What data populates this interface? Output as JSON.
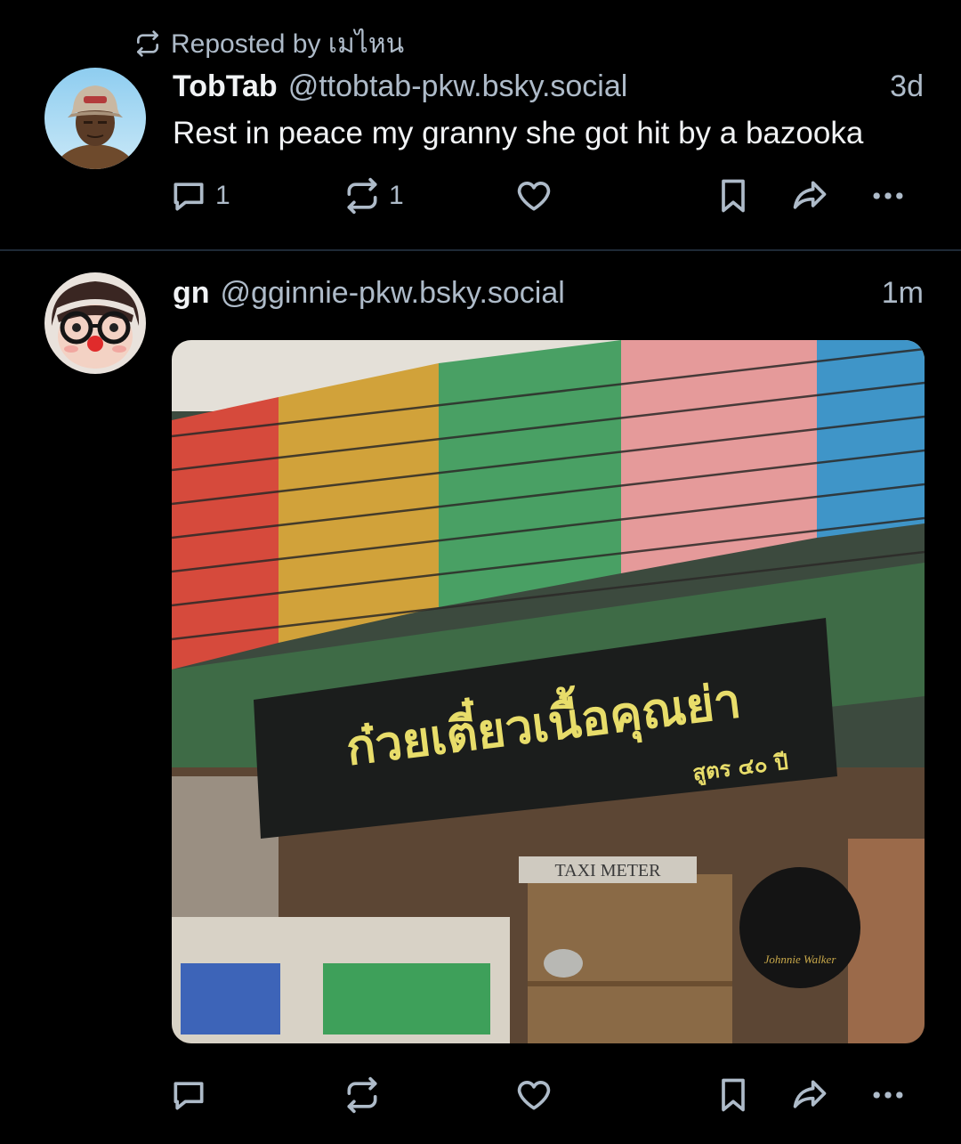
{
  "feed": {
    "post1": {
      "repost_label": "Reposted by เมไหน",
      "display_name": "TobTab",
      "handle": "@ttobtab-pkw.bsky.social",
      "time": "3d",
      "text": "Rest in peace my granny she got hit by a bazooka",
      "reply_count": "1",
      "repost_count": "1",
      "icons": [
        "repost-icon",
        "reply-icon",
        "repost-icon",
        "like-icon",
        "bookmark-icon",
        "share-icon",
        "more-icon"
      ]
    },
    "post2": {
      "display_name": "gn",
      "handle": "@gginnie-pkw.bsky.social",
      "time": "1m",
      "image": {
        "sign_text": "ก๋วยเตี๋ยวเนื้อคุณย่า",
        "sign_subtext": "สูตร ๔๐ ปี",
        "meter_text": "TAXI METER",
        "logo_text": "Johnnie Walker"
      },
      "icons": [
        "reply-icon",
        "repost-icon",
        "like-icon",
        "bookmark-icon",
        "share-icon",
        "more-icon"
      ]
    }
  },
  "colors": {
    "background": "#000000",
    "text": "#f1f3f5",
    "secondary_text": "#aebbc9",
    "divider": "#1e2936"
  }
}
